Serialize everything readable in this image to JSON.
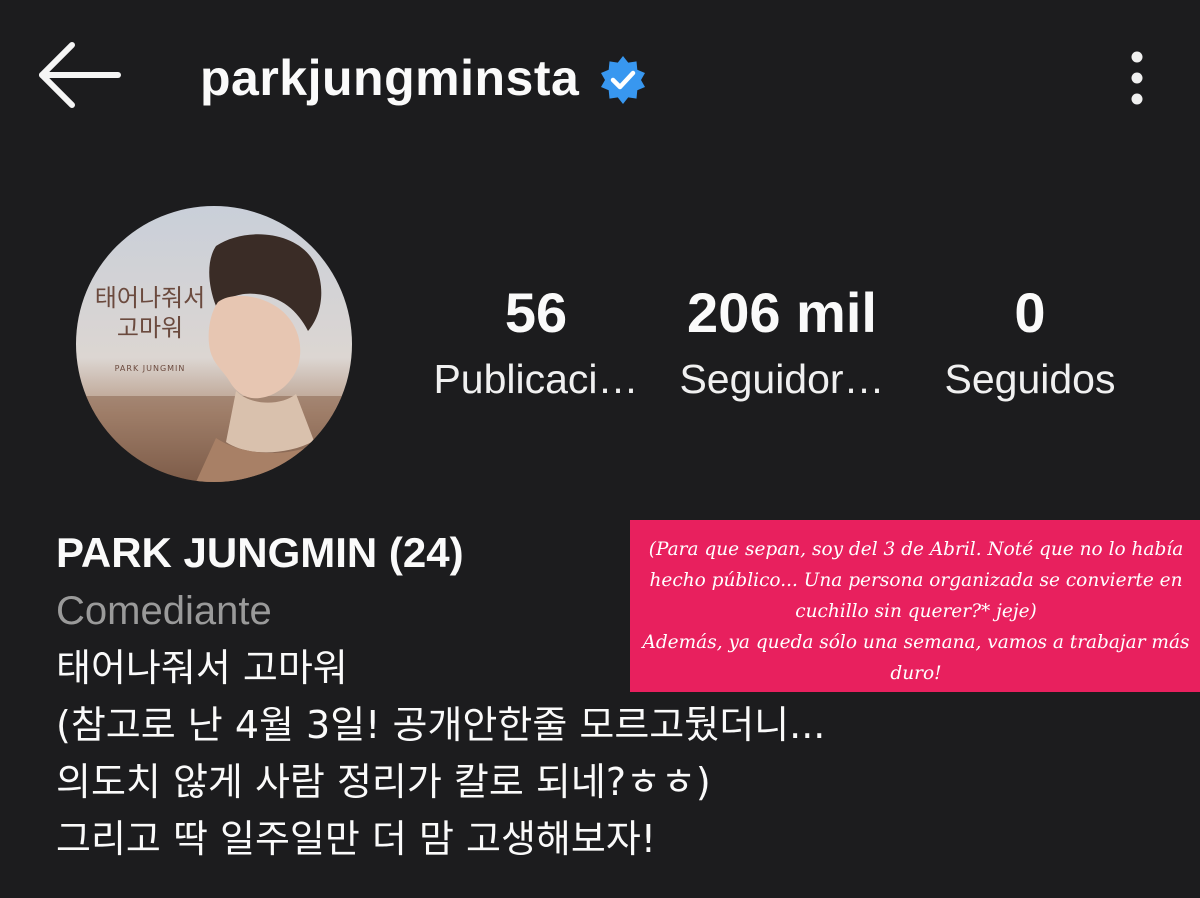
{
  "header": {
    "username": "parkjungminsta",
    "verified": true,
    "back_icon": "arrow-left-icon",
    "menu_icon": "more-vertical-icon"
  },
  "profile": {
    "avatar": {
      "cover_text_line1": "태어나줘서",
      "cover_text_line2": "고마워",
      "cover_artist": "PARK JUNGMIN"
    },
    "stats": [
      {
        "value": "56",
        "label": "Publicaci…"
      },
      {
        "value": "206 mil",
        "label": "Seguidor…"
      },
      {
        "value": "0",
        "label": "Seguidos"
      }
    ]
  },
  "bio": {
    "name": "PARK JUNGMIN (24)",
    "category": "Comediante",
    "lines": [
      "태어나줘서 고마워",
      "(참고로 난 4월 3일! 공개안한줄 모르고뒀더니...",
      "의도치 않게 사람 정리가 칼로 되네?ㅎㅎ)",
      "그리고 딱 일주일만 더 맘 고생해보자!"
    ]
  },
  "translation_note": {
    "paragraph1": "(Para que sepan, soy del 3 de Abril. Noté que no lo había hecho público... Una persona organizada se convierte en cuchillo sin querer?* jeje)",
    "paragraph2": "Además, ya queda sólo una semana, vamos a trabajar más duro!"
  },
  "colors": {
    "background": "#1c1c1e",
    "text": "#fafafa",
    "muted": "#9a9a9a",
    "verified_blue": "#3897f0",
    "note_pink": "#e8205e"
  }
}
